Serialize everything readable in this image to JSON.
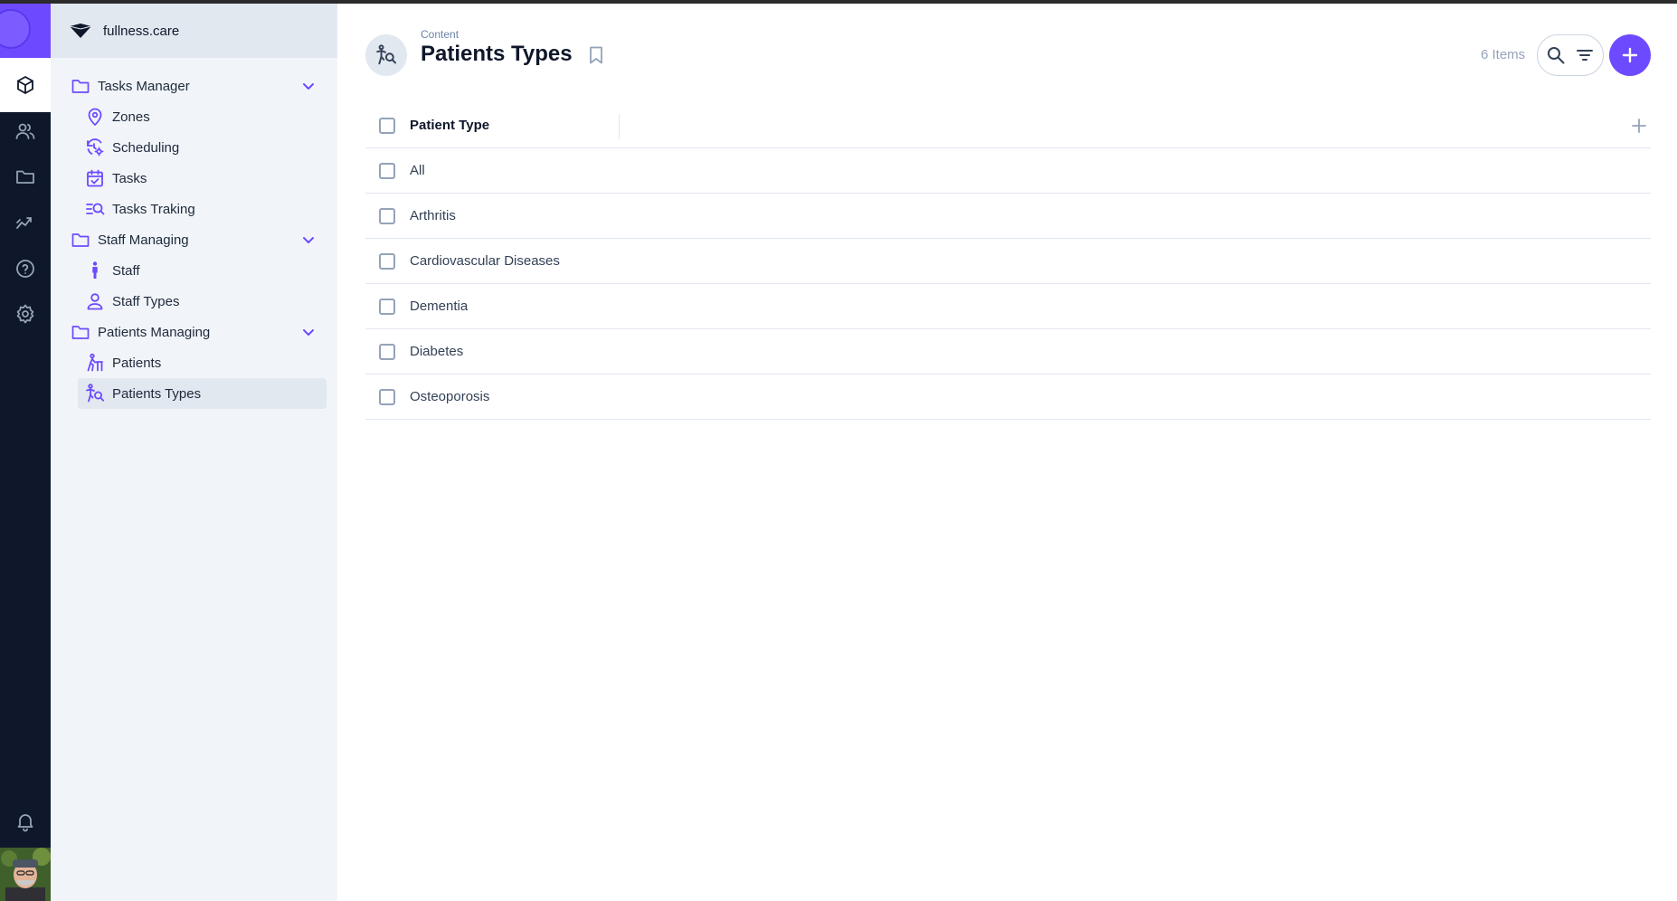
{
  "org": {
    "name": "fullness.care"
  },
  "rail": {
    "icons": [
      "logo-icon",
      "box-icon",
      "users-icon",
      "folder-icon",
      "chart-icon",
      "help-icon",
      "settings-icon",
      "bell-icon",
      "avatar"
    ]
  },
  "sidebar": {
    "groups": [
      {
        "label": "Tasks Manager",
        "items": [
          {
            "label": "Zones",
            "icon": "map-pin-icon"
          },
          {
            "label": "Scheduling",
            "icon": "clock-gear-icon"
          },
          {
            "label": "Tasks",
            "icon": "calendar-check-icon"
          },
          {
            "label": "Tasks Traking",
            "icon": "list-search-icon"
          }
        ]
      },
      {
        "label": "Staff Managing",
        "items": [
          {
            "label": "Staff",
            "icon": "person-icon"
          },
          {
            "label": "Staff Types",
            "icon": "user-icon"
          }
        ]
      },
      {
        "label": "Patients Managing",
        "items": [
          {
            "label": "Patients",
            "icon": "patient-walker-icon"
          },
          {
            "label": "Patients Types",
            "icon": "patient-search-icon"
          }
        ]
      }
    ]
  },
  "header": {
    "breadcrumb": "Content",
    "title": "Patients Types",
    "count": "6 Items"
  },
  "table": {
    "column": "Patient Type",
    "rows": [
      "All",
      "Arthritis",
      "Cardiovascular Diseases",
      "Dementia",
      "Diabetes",
      "Osteoporosis"
    ]
  },
  "colors": {
    "accent": "#6d4aff",
    "rail": "#0f172a",
    "sidebar": "#f1f5f9"
  }
}
